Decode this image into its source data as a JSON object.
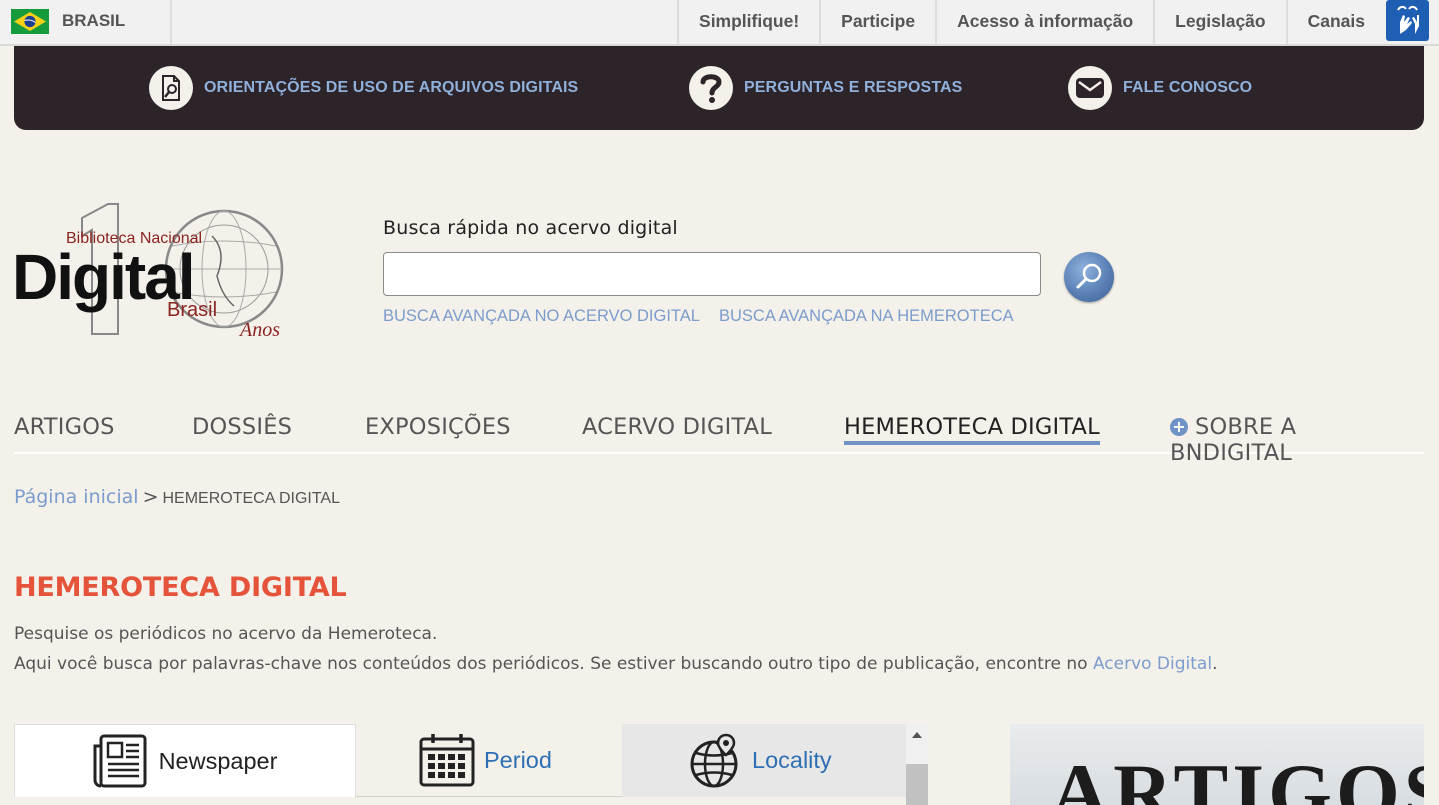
{
  "gov": {
    "brand": "BRASIL",
    "links": [
      "Simplifique!",
      "Participe",
      "Acesso à informação",
      "Legislação",
      "Canais"
    ]
  },
  "topbar": {
    "guide": "ORIENTAÇÕES DE USO DE ARQUIVOS DIGITAIS",
    "faq": "PERGUNTAS E RESPOSTAS",
    "contact": "FALE CONOSCO"
  },
  "logo": {
    "line1": "Biblioteca Nacional",
    "line2": "Digital",
    "line3": "Brasil",
    "line4": "Anos"
  },
  "search": {
    "title": "Busca rápida no acervo digital",
    "value": "",
    "advanced_digital": "BUSCA AVANÇADA NO ACERVO DIGITAL",
    "advanced_hemeroteca": "BUSCA AVANÇADA NA HEMEROTECA"
  },
  "nav": {
    "artigos": "ARTIGOS",
    "dossies": "DOSSIÊS",
    "exposicoes": "EXPOSIÇÕES",
    "acervo": "ACERVO DIGITAL",
    "hemeroteca": "HEMEROTECA DIGITAL",
    "sobre": "SOBRE A BNDIGITAL"
  },
  "breadcrumb": {
    "home": "Página inicial",
    "separator": ">",
    "current": "HEMEROTECA DIGITAL"
  },
  "page": {
    "title": "HEMEROTECA DIGITAL",
    "line1": "Pesquise os periódicos no acervo da Hemeroteca.",
    "line2_prefix": "Aqui você busca por palavras-chave nos conteúdos dos periódicos. Se estiver buscando outro tipo de publicação, encontre no ",
    "line2_link": "Acervo Digital",
    "line2_suffix": "."
  },
  "tabs": {
    "newspaper": "Newspaper",
    "period": "Period",
    "locality": "Locality"
  },
  "banner": {
    "text": "ARTIGOS"
  },
  "colors": {
    "background": "#f4f1ea",
    "topbar": "#2d242a",
    "link_blue": "#7b9ccc",
    "title_red": "#e4533a",
    "active_underline": "#6f93c4"
  }
}
